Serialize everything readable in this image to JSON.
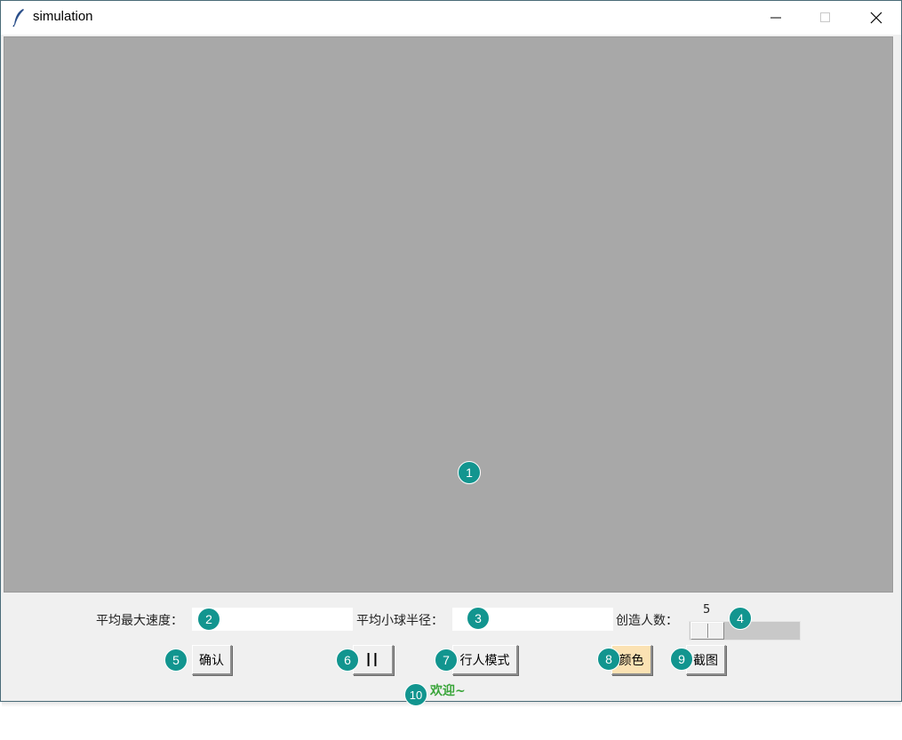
{
  "window": {
    "title": "simulation"
  },
  "controls": {
    "max_speed_label": "平均最大速度：",
    "max_speed_value": "",
    "radius_label": "平均小球半径：",
    "radius_value": "",
    "people_label": "创造人数：",
    "people_value": "5",
    "people_level_fraction": 0.0
  },
  "buttons": {
    "confirm": "确认",
    "pause": "II",
    "pedestrian_mode": "行人模式",
    "color": "颜色",
    "screenshot": "截图"
  },
  "status": {
    "text": "欢迎~"
  },
  "annotations": [
    "1",
    "2",
    "3",
    "4",
    "5",
    "6",
    "7",
    "8",
    "9",
    "10"
  ],
  "colors": {
    "canvas": "#a8a8a8",
    "color_button": "#fbe2b3",
    "status_text": "#3aa53a",
    "marker": "#12958f"
  }
}
